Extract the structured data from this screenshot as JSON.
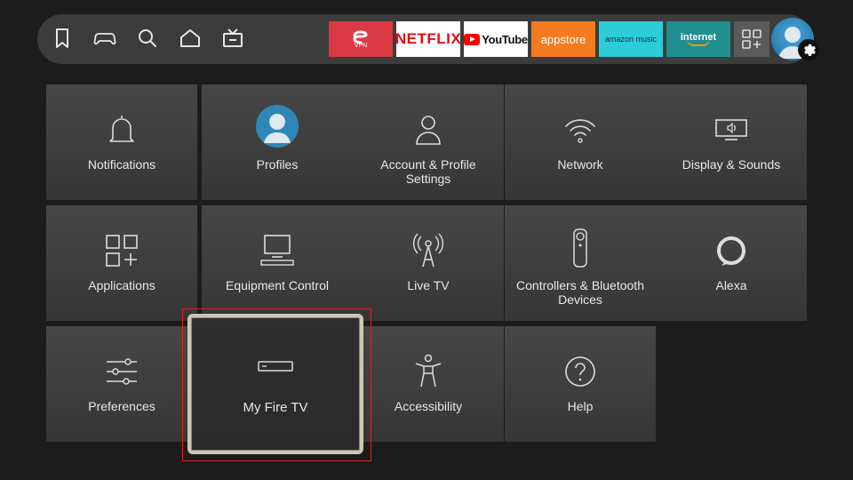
{
  "topbar": {
    "nav": [
      {
        "name": "bookmark-icon"
      },
      {
        "name": "gamepad-icon"
      },
      {
        "name": "search-icon"
      },
      {
        "name": "home-icon"
      },
      {
        "name": "live-tv-icon"
      }
    ],
    "apps": {
      "vpn_label": "VPN",
      "netflix_label": "NETFLIX",
      "youtube_label": "YouTube",
      "appstore_label": "appstore",
      "amazonmusic_label": "amazon music",
      "internet_label": "internet"
    }
  },
  "settings": {
    "tiles": [
      {
        "label": "Notifications",
        "icon": "bell-icon"
      },
      {
        "label": "Profiles",
        "icon": "profile-avatar-icon"
      },
      {
        "label": "Account & Profile Settings",
        "icon": "person-icon"
      },
      {
        "label": "Network",
        "icon": "wifi-icon"
      },
      {
        "label": "Display & Sounds",
        "icon": "display-icon"
      },
      {
        "label": "Applications",
        "icon": "applications-icon"
      },
      {
        "label": "Equipment Control",
        "icon": "tv-equipment-icon"
      },
      {
        "label": "Live TV",
        "icon": "antenna-icon"
      },
      {
        "label": "Controllers & Bluetooth Devices",
        "icon": "remote-icon"
      },
      {
        "label": "Alexa",
        "icon": "alexa-icon"
      },
      {
        "label": "Preferences",
        "icon": "sliders-icon"
      },
      {
        "label": "My Fire TV",
        "icon": "fire-tv-device-icon",
        "focused": true
      },
      {
        "label": "Accessibility",
        "icon": "accessibility-icon"
      },
      {
        "label": "Help",
        "icon": "help-icon"
      }
    ]
  },
  "colors": {
    "background": "#1c1c1c",
    "tile": "#404040",
    "focus_border": "#cfc7b6",
    "highlight_box": "#e02020"
  }
}
